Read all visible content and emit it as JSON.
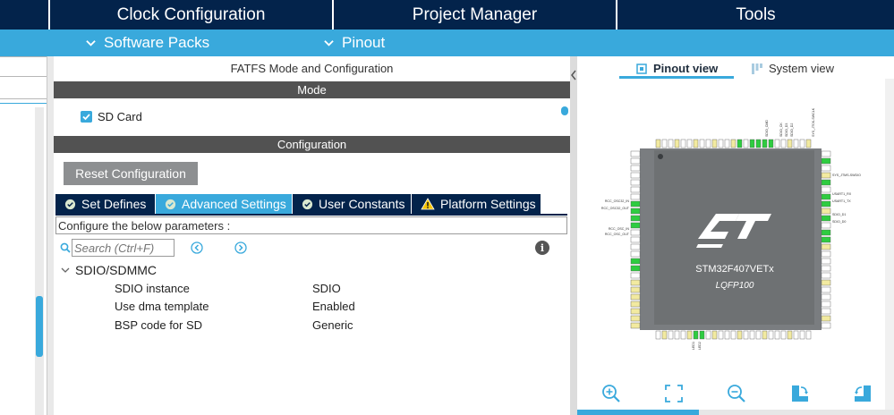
{
  "top_tabs": {
    "clock": "Clock Configuration",
    "project": "Project Manager",
    "tools": "Tools"
  },
  "sub_menu": {
    "software_packs": "Software Packs",
    "pinout": "Pinout"
  },
  "panel": {
    "title": "FATFS Mode and Configuration",
    "mode_header": "Mode",
    "sd_card_label": "SD Card",
    "sd_card_checked": true,
    "configuration_header": "Configuration",
    "reset_button": "Reset Configuration",
    "tabs": [
      {
        "label": "Set Defines",
        "icon": "check-circle-icon",
        "active": false
      },
      {
        "label": "Advanced Settings",
        "icon": "check-circle-icon",
        "active": true
      },
      {
        "label": "User Constants",
        "icon": "check-circle-icon",
        "active": false
      },
      {
        "label": "Platform Settings",
        "icon": "warning-icon",
        "active": false
      }
    ],
    "hint": "Configure the below parameters :",
    "search_placeholder": "Search (Ctrl+F)",
    "group": "SDIO/SDMMC",
    "params": [
      {
        "name": "SDIO instance",
        "value": "SDIO"
      },
      {
        "name": "Use dma template",
        "value": "Enabled"
      },
      {
        "name": "BSP code for SD",
        "value": "Generic"
      }
    ]
  },
  "view": {
    "pinout_view": "Pinout view",
    "system_view": "System view",
    "chip_name": "STM32F407VETx",
    "package": "LQFP100",
    "brand_logo": "ST",
    "pin_labels": {
      "left": [
        "RCC_OSC32_IN",
        "RCC_OSC32_OUT",
        "RCC_OSC_IN",
        "RCC_OSC_OUT"
      ],
      "right": [
        "SYS_JTMS-SWDIO",
        "USART1_RX",
        "USART1_TX",
        "SDIO_D1",
        "SDIO_D0"
      ],
      "top": [
        "SDIO_CMD",
        "SDIO_CK",
        "SDIO_D3",
        "SDIO_D2",
        "SYS_JTCK-SWCLK"
      ],
      "bottom": [
        "LED1",
        "LED2"
      ]
    },
    "tools": [
      "zoom-in-icon",
      "fit-screen-icon",
      "zoom-out-icon",
      "rotate-right-icon",
      "rotate-left-icon"
    ]
  },
  "colors": {
    "navy": "#03234b",
    "accent": "#39a9dc",
    "header_gray": "#525252",
    "button_gray": "#8d8f91",
    "pin_green": "#2ecc40",
    "pin_yellow": "#f2eaa0",
    "chip_body": "#6e7173"
  }
}
